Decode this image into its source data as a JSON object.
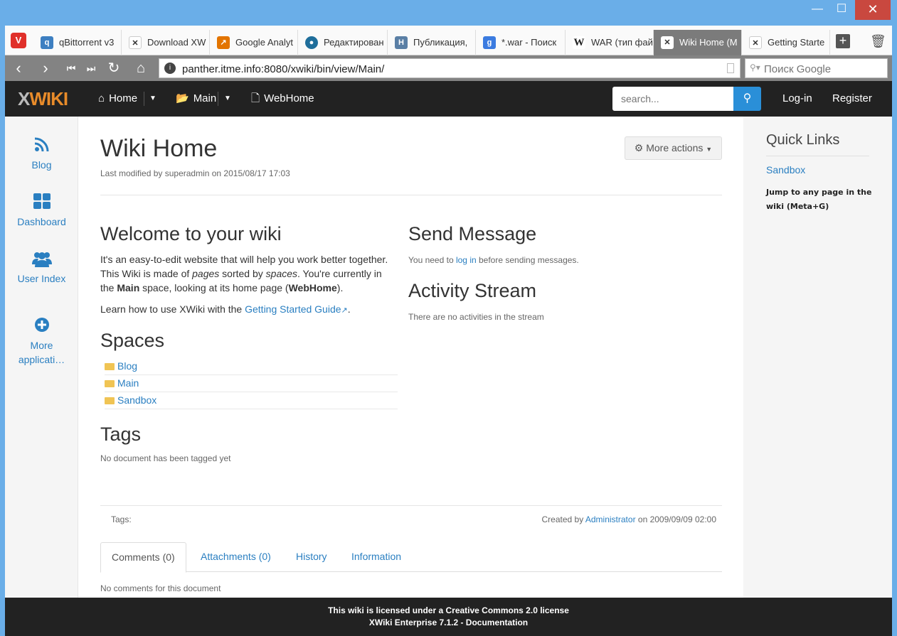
{
  "window": {
    "minimize": "—",
    "maximize": "☐",
    "close": "✕"
  },
  "tabs": [
    {
      "label": "qBittorrent v3",
      "icon": "qbittorrent-icon",
      "color": "#3d7fc1"
    },
    {
      "label": "Download XW",
      "icon": "xwiki-icon",
      "color": "#333333"
    },
    {
      "label": "Google Analyt",
      "icon": "analytics-icon",
      "color": "#e37400"
    },
    {
      "label": "Редактирован",
      "icon": "habr-icon",
      "color": "#1f6e9b"
    },
    {
      "label": "Публикация, ",
      "icon": "h-icon",
      "color": "#5a7fa5"
    },
    {
      "label": "*.war - Поиск",
      "icon": "google-icon",
      "color": "#3b7be0"
    },
    {
      "label": "WAR (тип фай",
      "icon": "wikipedia-icon",
      "color": "#333333"
    },
    {
      "label": "Wiki Home (M",
      "icon": "xwiki-icon",
      "color": "#ffffff"
    },
    {
      "label": "Getting Starte",
      "icon": "xwiki-icon",
      "color": "#333333"
    }
  ],
  "address": {
    "url": "panther.itme.info:8080/xwiki/bin/view/Main/",
    "search_placeholder": "Поиск Google"
  },
  "xnav": {
    "logo_x": "X",
    "logo_text": "WIKI",
    "home": "Home",
    "main": "Main",
    "page": "WebHome",
    "search_placeholder": "search...",
    "login": "Log-in",
    "register": "Register"
  },
  "apps": [
    {
      "label": "Blog",
      "icon": "rss-icon"
    },
    {
      "label": "Dashboard",
      "icon": "dashboard-icon"
    },
    {
      "label": "User Index",
      "icon": "users-icon"
    },
    {
      "label": "More applicati…",
      "icon": "plus-circle-icon"
    }
  ],
  "page": {
    "title": "Wiki Home",
    "last_modified": "Last modified by superadmin on 2015/08/17 17:03",
    "more_actions": "More actions",
    "welcome_heading": "Welcome to your wiki",
    "welcome_p1_a": "It's an easy-to-edit website that will help you work better together. This Wiki is made of ",
    "welcome_p1_pages": "pages",
    "welcome_p1_b": " sorted by ",
    "welcome_p1_spaces": "spaces",
    "welcome_p1_c": ". You're currently in the ",
    "welcome_p1_main": "Main",
    "welcome_p1_d": " space, looking at its home page (",
    "welcome_p1_webhome": "WebHome",
    "welcome_p1_e": ").",
    "learn_a": "Learn how to use XWiki with the ",
    "learn_link": "Getting Started Guide",
    "learn_b": ".",
    "spaces_heading": "Spaces",
    "spaces": [
      "Blog",
      "Main",
      "Sandbox"
    ],
    "tags_heading": "Tags",
    "no_tags": "No document has been tagged yet",
    "send_heading": "Send Message",
    "send_a": "You need to ",
    "send_link": "log in",
    "send_b": " before sending messages.",
    "activity_heading": "Activity Stream",
    "activity_empty": "There are no activities in the stream",
    "tags_label": "Tags:",
    "created_a": "Created by ",
    "created_author": "Administrator",
    "created_b": " on 2009/09/09 02:00",
    "doc_tabs": [
      "Comments (0)",
      "Attachments (0)",
      "History",
      "Information"
    ],
    "no_comments": "No comments for this document"
  },
  "quick_links": {
    "title": "Quick Links",
    "sandbox": "Sandbox",
    "jump": "Jump to any page in the wiki (Meta+G)"
  },
  "footer": {
    "line1": "This wiki is licensed under a Creative Commons 2.0 license",
    "line2": "XWiki Enterprise 7.1.2 - Documentation"
  }
}
